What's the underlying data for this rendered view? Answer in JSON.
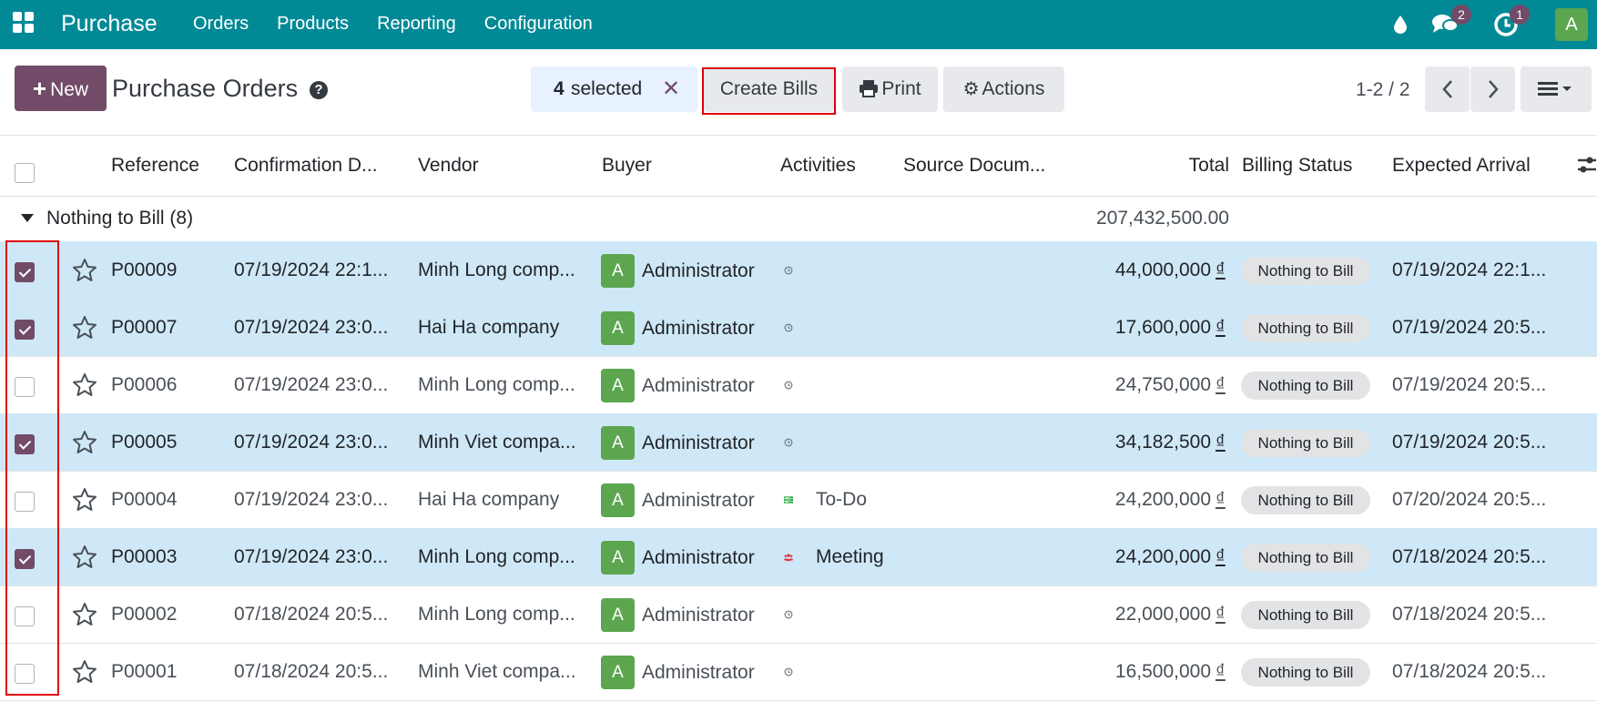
{
  "navbar": {
    "app_title": "Purchase",
    "menu": [
      "Orders",
      "Products",
      "Reporting",
      "Configuration"
    ],
    "messages_count": "2",
    "activities_count": "1",
    "user_initial": "A",
    "bg_color": "#018a96"
  },
  "control_panel": {
    "new_label": "New",
    "title": "Purchase Orders",
    "help_icon": "?",
    "selected_count": "4",
    "selected_label": "selected",
    "unselect_icon": "✕",
    "create_bills_label": "Create Bills",
    "print_label": "Print",
    "actions_label": "Actions",
    "pager_text": "1-2 / 2"
  },
  "columns": {
    "reference": "Reference",
    "confirmation_date": "Confirmation D...",
    "vendor": "Vendor",
    "buyer": "Buyer",
    "activities": "Activities",
    "source_document": "Source Docum...",
    "total": "Total",
    "billing_status": "Billing Status",
    "expected_arrival": "Expected Arrival"
  },
  "group": {
    "label": "Nothing to Bill (8)",
    "total": "207,432,500.00"
  },
  "rows": [
    {
      "selected": true,
      "ref": "P00009",
      "date": "07/19/2024 22:1...",
      "vendor": "Minh Long comp...",
      "buyer_initial": "A",
      "buyer": "Administrator",
      "activity_icon": "clock-icon",
      "activity_label": "",
      "total": "44,000,000",
      "currency": "₫",
      "billing_status": "Nothing to Bill",
      "arrival": "07/19/2024 22:1..."
    },
    {
      "selected": true,
      "ref": "P00007",
      "date": "07/19/2024 23:0...",
      "vendor": "Hai Ha company",
      "buyer_initial": "A",
      "buyer": "Administrator",
      "activity_icon": "clock-icon",
      "activity_label": "",
      "total": "17,600,000",
      "currency": "₫",
      "billing_status": "Nothing to Bill",
      "arrival": "07/19/2024 20:5..."
    },
    {
      "selected": false,
      "ref": "P00006",
      "date": "07/19/2024 23:0...",
      "vendor": "Minh Long comp...",
      "buyer_initial": "A",
      "buyer": "Administrator",
      "activity_icon": "clock-icon",
      "activity_label": "",
      "total": "24,750,000",
      "currency": "₫",
      "billing_status": "Nothing to Bill",
      "arrival": "07/19/2024 20:5..."
    },
    {
      "selected": true,
      "ref": "P00005",
      "date": "07/19/2024 23:0...",
      "vendor": "Minh Viet compa...",
      "buyer_initial": "A",
      "buyer": "Administrator",
      "activity_icon": "clock-icon",
      "activity_label": "",
      "total": "34,182,500",
      "currency": "₫",
      "billing_status": "Nothing to Bill",
      "arrival": "07/19/2024 20:5..."
    },
    {
      "selected": false,
      "ref": "P00004",
      "date": "07/19/2024 23:0...",
      "vendor": "Hai Ha company",
      "buyer_initial": "A",
      "buyer": "Administrator",
      "activity_icon": "todo-icon",
      "activity_label": "To-Do",
      "total": "24,200,000",
      "currency": "₫",
      "billing_status": "Nothing to Bill",
      "arrival": "07/20/2024 20:5..."
    },
    {
      "selected": true,
      "ref": "P00003",
      "date": "07/19/2024 23:0...",
      "vendor": "Minh Long comp...",
      "buyer_initial": "A",
      "buyer": "Administrator",
      "activity_icon": "meeting-icon",
      "activity_label": "Meeting",
      "total": "24,200,000",
      "currency": "₫",
      "billing_status": "Nothing to Bill",
      "arrival": "07/18/2024 20:5..."
    },
    {
      "selected": false,
      "ref": "P00002",
      "date": "07/18/2024 20:5...",
      "vendor": "Minh Long comp...",
      "buyer_initial": "A",
      "buyer": "Administrator",
      "activity_icon": "clock-icon",
      "activity_label": "",
      "total": "22,000,000",
      "currency": "₫",
      "billing_status": "Nothing to Bill",
      "arrival": "07/18/2024 20:5..."
    },
    {
      "selected": false,
      "ref": "P00001",
      "date": "07/18/2024 20:5...",
      "vendor": "Minh Viet compa...",
      "buyer_initial": "A",
      "buyer": "Administrator",
      "activity_icon": "clock-icon",
      "activity_label": "",
      "total": "16,500,000",
      "currency": "₫",
      "billing_status": "Nothing to Bill",
      "arrival": "07/18/2024 20:5..."
    }
  ]
}
